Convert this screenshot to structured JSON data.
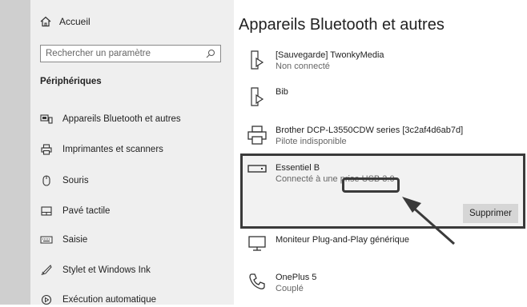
{
  "sidebar": {
    "home_label": "Accueil",
    "search_placeholder": "Rechercher un paramètre",
    "section_title": "Périphériques",
    "items": [
      {
        "label": "Appareils Bluetooth et autres",
        "icon": "bluetooth-devices-icon"
      },
      {
        "label": "Imprimantes et scanners",
        "icon": "printer-icon"
      },
      {
        "label": "Souris",
        "icon": "mouse-icon"
      },
      {
        "label": "Pavé tactile",
        "icon": "touchpad-icon"
      },
      {
        "label": "Saisie",
        "icon": "keyboard-icon"
      },
      {
        "label": "Stylet et Windows Ink",
        "icon": "pen-icon"
      },
      {
        "label": "Exécution automatique",
        "icon": "autoplay-icon"
      }
    ]
  },
  "main": {
    "title": "Appareils Bluetooth et autres",
    "devices": [
      {
        "name": "[Sauvegarde] TwonkyMedia",
        "status": "Non connecté",
        "icon": "media-device-icon"
      },
      {
        "name": "Bib",
        "status": "",
        "icon": "media-device-icon"
      },
      {
        "name": "Brother DCP-L3550CDW series [3c2af4d6ab7d]",
        "status": "Pilote indisponible",
        "icon": "printer-icon"
      },
      {
        "name": "Essentiel B",
        "status": "Connecté à une prise USB 3.0",
        "icon": "usb-drive-icon"
      },
      {
        "name": "Moniteur Plug-and-Play générique",
        "status": "",
        "icon": "monitor-icon"
      },
      {
        "name": "OnePlus 5",
        "status": "Couplé",
        "icon": "phone-icon"
      }
    ],
    "remove_button_label": "Supprimer"
  },
  "colors": {
    "sidebar_bg": "#efefef",
    "outer_bg": "#cfcfcf",
    "highlight_border": "#3a3a3a",
    "button_bg": "#d6d6d6"
  }
}
